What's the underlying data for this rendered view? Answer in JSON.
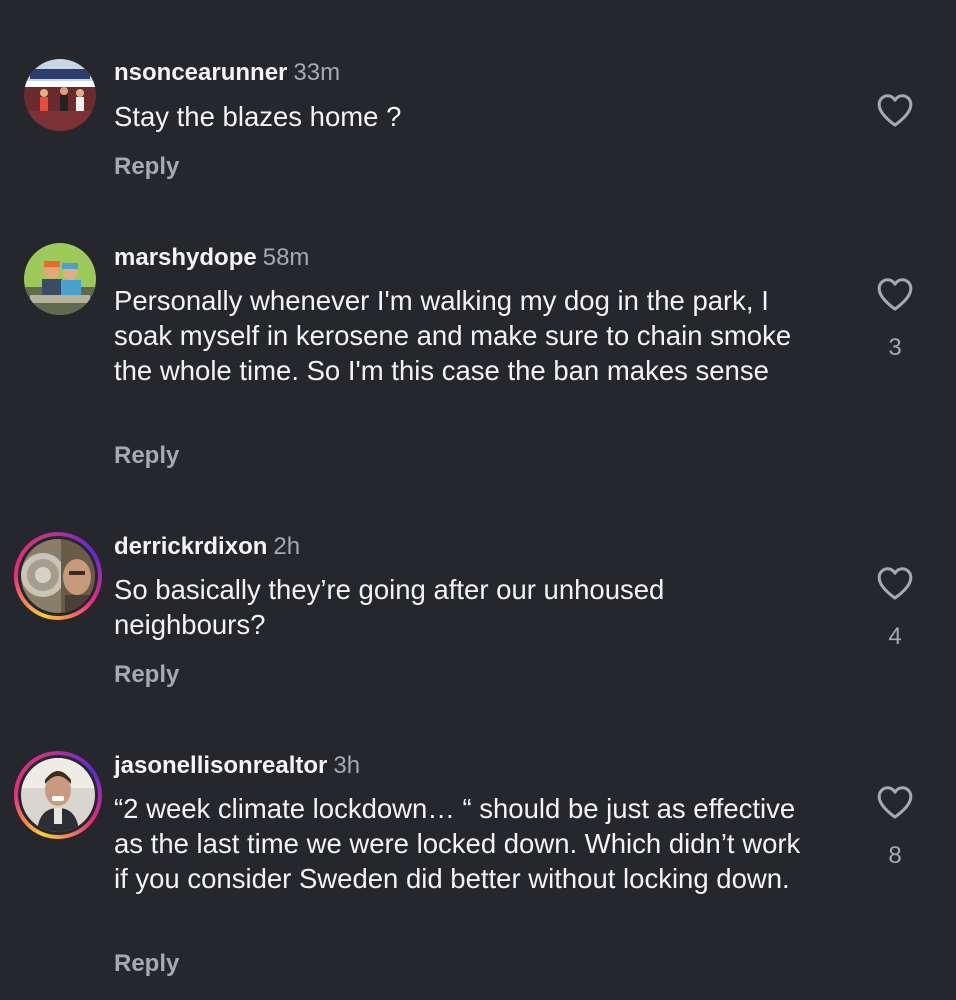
{
  "comments": [
    {
      "username": "nsoncearunner",
      "time": "33m",
      "text": "Stay the blazes home ?",
      "reply_label": "Reply",
      "likes": "",
      "story_ring": false
    },
    {
      "username": "marshydope",
      "time": "58m",
      "text": "Personally whenever I'm walking my dog in the park, I soak myself in kerosene and make sure to chain smoke the whole time. So I'm this case the ban makes sense",
      "reply_label": "Reply",
      "likes": "3",
      "story_ring": false
    },
    {
      "username": "derrickrdixon",
      "time": "2h",
      "text": "So basically they’re going after our unhoused neighbours?",
      "reply_label": "Reply",
      "likes": "4",
      "story_ring": true
    },
    {
      "username": "jasonellisonrealtor",
      "time": "3h",
      "text": "“2 week climate lockdown… “ should be just as effective as the last time we were locked down. Which didn’t work if you consider Sweden did better without locking down.",
      "reply_label": "Reply",
      "likes": "8",
      "story_ring": true
    }
  ],
  "icons": {
    "like": "heart-outline-icon"
  },
  "colors": {
    "background": "#25272c",
    "primary_text": "#f4f4f4",
    "secondary_text": "#a7a9ae",
    "story_ring_gradient": [
      "#f9ce34",
      "#ee2a7b",
      "#6228d7"
    ]
  }
}
